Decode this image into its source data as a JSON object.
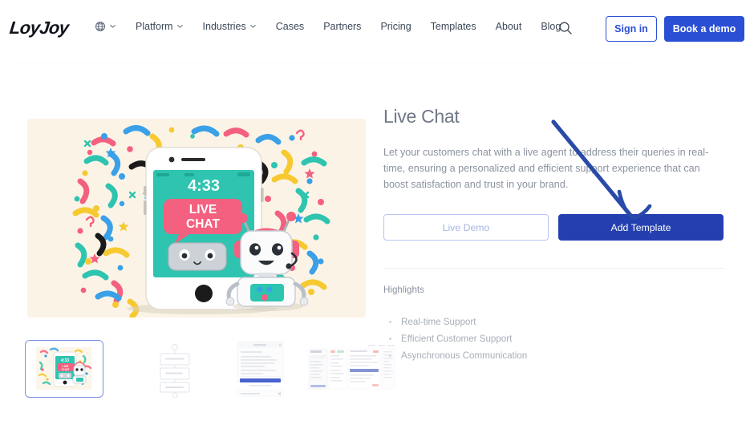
{
  "brand": {
    "logo": "LoyJoy",
    "accent_primary": "#2a4fd4",
    "accent_deep": "#2440b0"
  },
  "nav": {
    "language_icon": "globe-icon",
    "language_chevron": "chevron-down-icon",
    "items": [
      {
        "label": "Platform",
        "has_chevron": true
      },
      {
        "label": "Industries",
        "has_chevron": true
      },
      {
        "label": "Cases",
        "has_chevron": false
      },
      {
        "label": "Partners",
        "has_chevron": false
      },
      {
        "label": "Pricing",
        "has_chevron": false
      },
      {
        "label": "Templates",
        "has_chevron": false
      },
      {
        "label": "About",
        "has_chevron": false
      },
      {
        "label": "Blog",
        "has_chevron": false
      }
    ],
    "search_icon": "search-icon",
    "sign_in": "Sign in",
    "book_demo": "Book a demo"
  },
  "detail": {
    "title": "Live Chat",
    "description": "Let your customers chat with a live agent to address their queries in real-time, ensuring a personalized and efficient support experience that can boost satisfaction and trust in your brand.",
    "live_demo_button": "Live Demo",
    "add_template_button": "Add Template",
    "highlights_label": "Highlights",
    "highlights": [
      "Real-time Support",
      "Efficient Customer Support",
      "Asynchronous Communication"
    ]
  },
  "gallery": {
    "hero": {
      "alt": "live-chat-illustration",
      "phone_time": "4:33",
      "bubble_line1": "LIVE",
      "bubble_line2": "CHAT",
      "background_color": "#fbf4e6",
      "screen_color": "#2ec4b0",
      "bubble_color": "#f4607f"
    },
    "thumbnails": [
      {
        "name": "thumb-hero-illustration",
        "selected": true
      },
      {
        "name": "thumb-flow-diagram",
        "selected": false
      },
      {
        "name": "thumb-chat-preview",
        "selected": false
      },
      {
        "name": "thumb-dashboard-preview",
        "selected": false
      }
    ]
  },
  "annotation": {
    "name": "arrow-pointing-to-add-template",
    "color": "#2a4aa8"
  }
}
